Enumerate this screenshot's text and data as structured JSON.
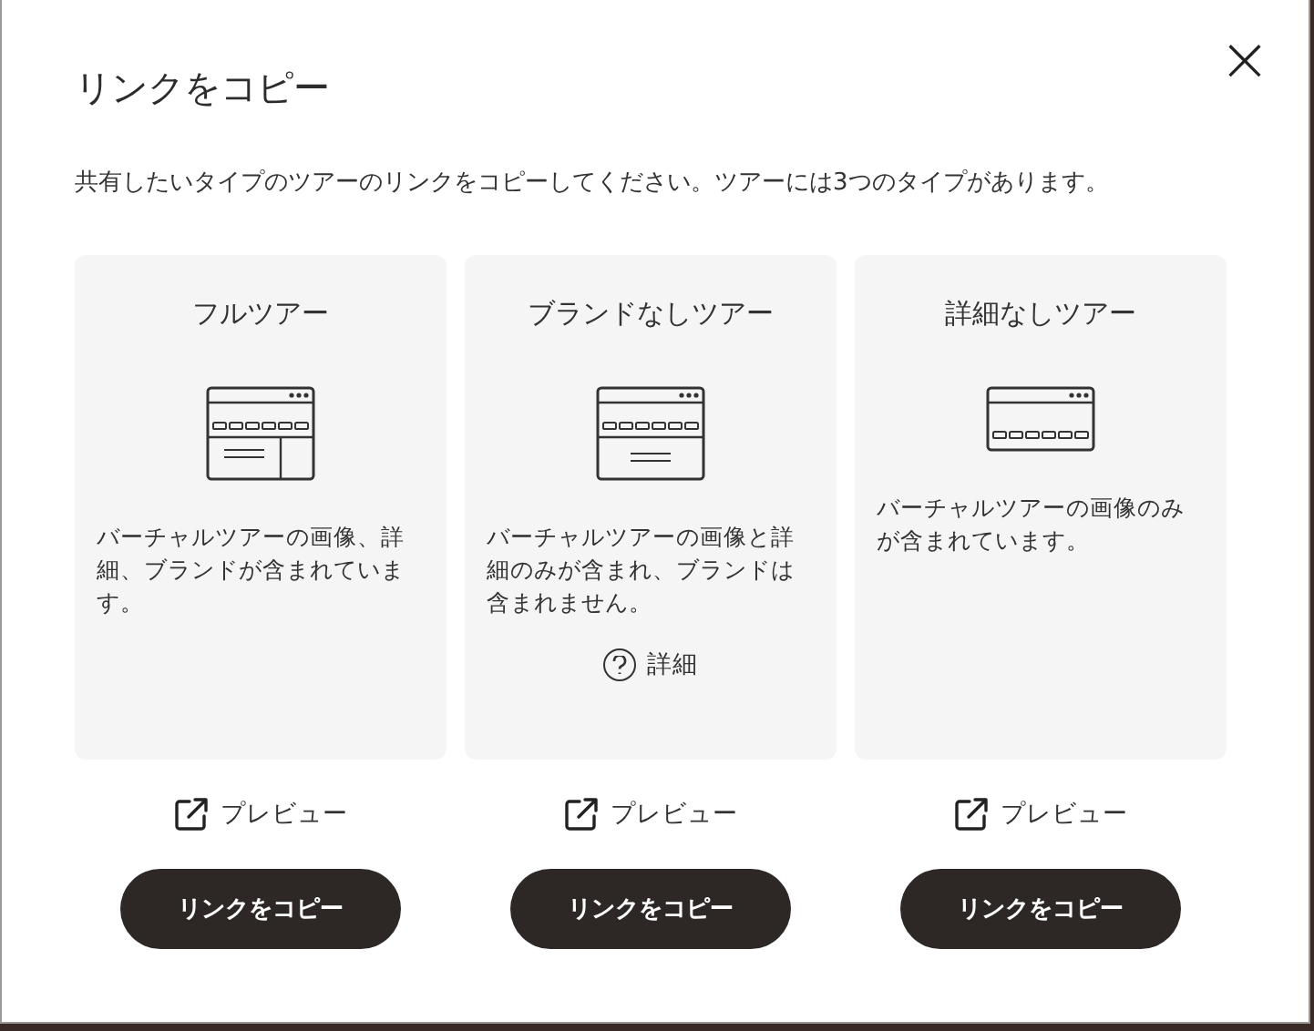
{
  "dialog": {
    "title": "リンクをコピー",
    "close": "×",
    "description": "共有したいタイプのツアーのリンクをコピーしてください。ツアーには3つのタイプがあります。"
  },
  "options": [
    {
      "kind": "full",
      "title": "フルツアー",
      "description": "バーチャルツアーの画像、詳細、ブランドが含まれています。",
      "preview": "プレビュー",
      "button": "リンクをコピー"
    },
    {
      "kind": "unbranded",
      "title": "ブランドなしツアー",
      "description": "バーチャルツアーの画像と詳細のみが含まれ、ブランドは含まれません。",
      "help": "詳細",
      "preview": "プレビュー",
      "button": "リンクをコピー"
    },
    {
      "kind": "nodetail",
      "title": "詳細なしツアー",
      "description": "バーチャルツアーの画像のみが含まれています。",
      "preview": "プレビュー",
      "button": "リンクをコピー"
    }
  ]
}
